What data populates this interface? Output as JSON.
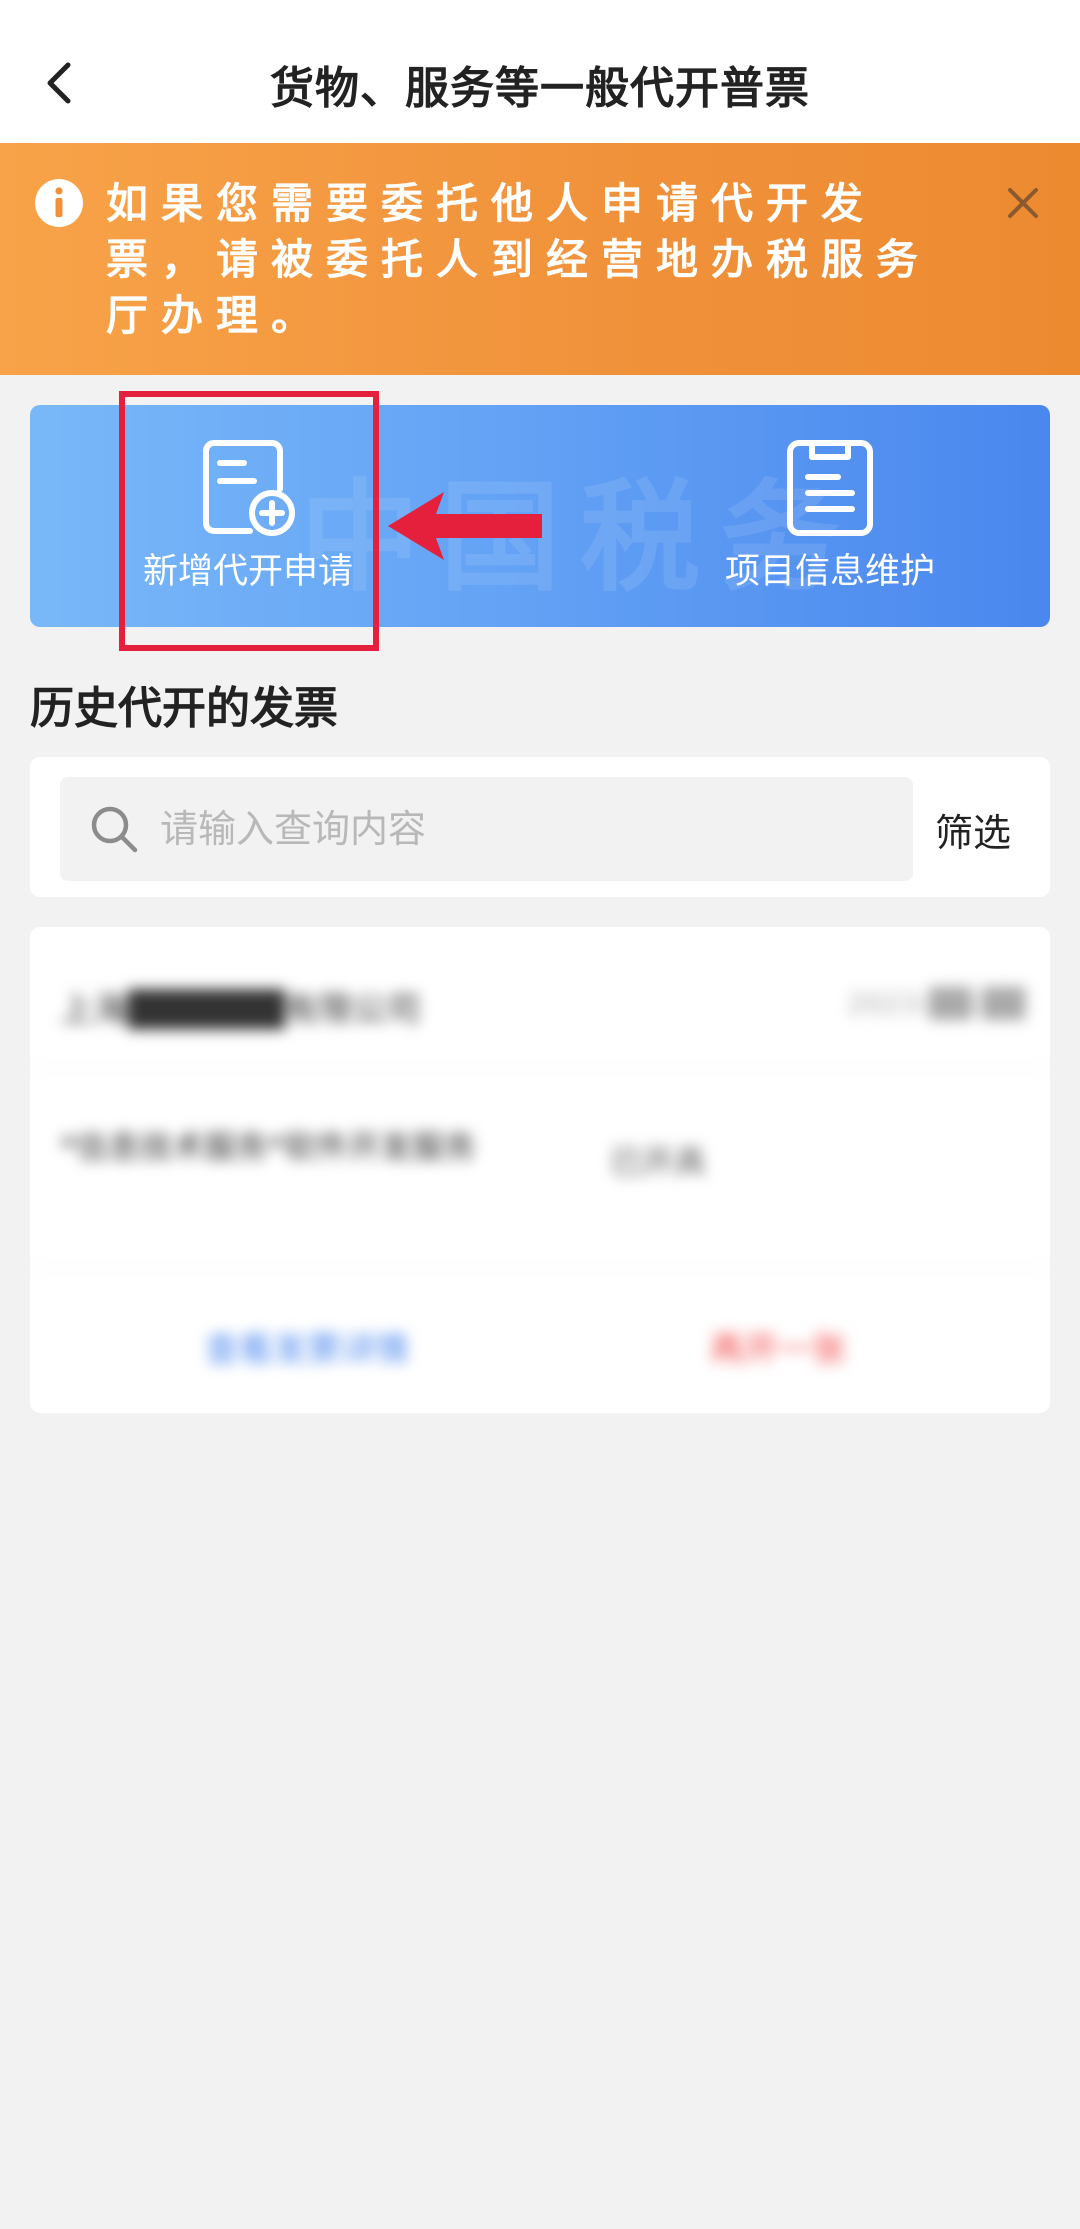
{
  "header": {
    "title": "货物、服务等一般代开普票",
    "back_icon": "chevron-left-icon"
  },
  "notice": {
    "text": "如果您需要委托他人申请代开发票，请被委托人到经营地办税服务厅办理。",
    "info_icon": "info-icon",
    "close_icon": "close-icon",
    "background_color": "#f0913a"
  },
  "actions": {
    "new_application": {
      "label": "新增代开申请",
      "icon": "document-add-icon"
    },
    "project_maintenance": {
      "label": "项目信息维护",
      "icon": "clipboard-list-icon"
    },
    "watermark": "中国税务",
    "background_color": "#4a87ee"
  },
  "history": {
    "title": "历史代开的发票",
    "search": {
      "placeholder": "请输入查询内容",
      "value": ""
    },
    "filter_label": "筛选",
    "records": [
      {
        "company": "上海██████有限公司",
        "date": "2023-██-██",
        "item": "*信息技术服务*软件开发服务",
        "status": "已开具",
        "action_left": "查看发票详情",
        "action_right": "再开一张"
      }
    ]
  },
  "annotation_color": "#e5203c"
}
